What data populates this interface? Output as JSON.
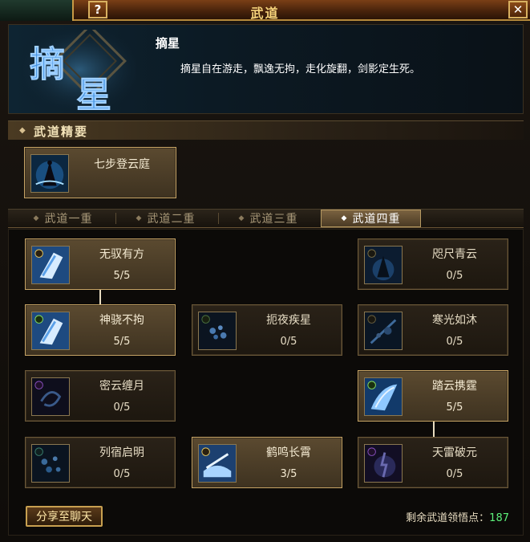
{
  "window": {
    "title": "武道",
    "help_label": "?",
    "close_label": "✕"
  },
  "header": {
    "emblem_text": "摘星",
    "skill_name": "摘星",
    "description": "摘星自在游走，飘逸无拘，走化旋翻，剑影定生死。"
  },
  "essence": {
    "section_label": "武道精要",
    "card": {
      "name": "七步登云庭",
      "icon": "figure-in-clouds-icon"
    }
  },
  "tabs": [
    {
      "label": "武道一重",
      "active": false
    },
    {
      "label": "武道二重",
      "active": false
    },
    {
      "label": "武道三重",
      "active": false
    },
    {
      "label": "武道四重",
      "active": true
    }
  ],
  "skills": [
    {
      "name": "无驭有方",
      "count": "5/5",
      "icon": "swift-boot-icon",
      "active": true
    },
    {
      "name": "咫尺青云",
      "count": "0/5",
      "icon": "cloud-figure-icon",
      "active": false
    },
    {
      "name": "神骁不拘",
      "count": "5/5",
      "icon": "swift-boot-icon",
      "active": true
    },
    {
      "name": "扼夜疾星",
      "count": "0/5",
      "icon": "star-orbs-icon",
      "active": false
    },
    {
      "name": "寒光如沐",
      "count": "0/5",
      "icon": "cold-light-icon",
      "active": false
    },
    {
      "name": "密云缠月",
      "count": "0/5",
      "icon": "swirl-moon-icon",
      "active": false
    },
    {
      "name": "踏云携霆",
      "count": "5/5",
      "icon": "wing-icon",
      "active": true
    },
    {
      "name": "列宿启明",
      "count": "0/5",
      "icon": "star-orbs-icon",
      "active": false
    },
    {
      "name": "鹤鸣长霄",
      "count": "3/5",
      "icon": "sword-wave-icon",
      "active": true
    },
    {
      "name": "天雷破元",
      "count": "0/5",
      "icon": "thunder-figure-icon",
      "active": false
    }
  ],
  "footer": {
    "share_label": "分享至聊天",
    "points_label": "剩余武道领悟点：",
    "points_value": "187"
  },
  "colors": {
    "accent_gold": "#c7a465",
    "points_green": "#5cf07a",
    "title_gold": "#f5d27a"
  }
}
